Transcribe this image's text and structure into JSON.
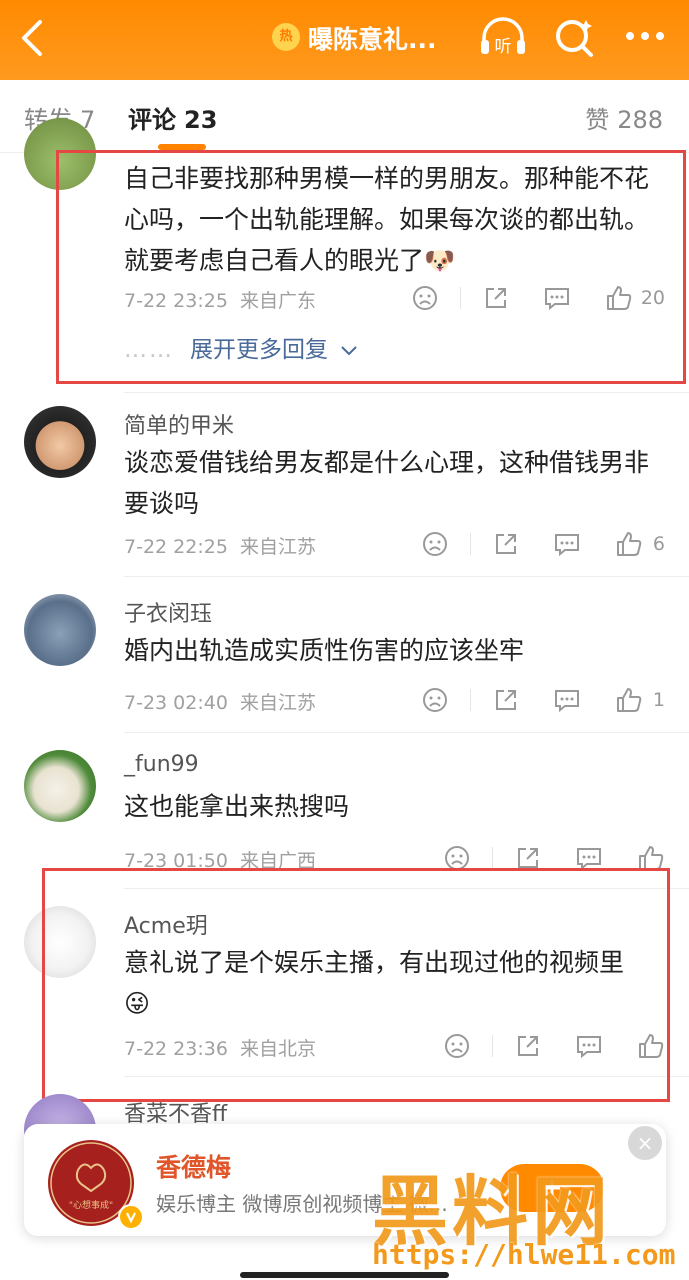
{
  "header": {
    "badge": "热",
    "title": "曝陈意礼...",
    "listen_label": "听"
  },
  "tabs": {
    "repost": {
      "label": "转发",
      "count": "7"
    },
    "comment": {
      "label": "评论",
      "count": "23"
    },
    "like": {
      "label": "赞",
      "count": "288"
    }
  },
  "comments": [
    {
      "username": "",
      "text": "自己非要找那种男模一样的男朋友。那种能不花心吗，一个出轨能理解。如果每次谈的都出轨。就要考虑自己看人的眼光了",
      "emoji": "🐶",
      "time": "7-22 23:25",
      "location": "来自广东",
      "likes": "20",
      "more_replies": "展开更多回复"
    },
    {
      "username": "简单的甲米",
      "text": "谈恋爱借钱给男友都是什么心理，这种借钱男非要谈吗",
      "time": "7-22 22:25",
      "location": "来自江苏",
      "likes": "6"
    },
    {
      "username": "子衣闵珏",
      "text": "婚内出轨造成实质性伤害的应该坐牢",
      "time": "7-23 02:40",
      "location": "来自江苏",
      "likes": "1"
    },
    {
      "username": "_fun99",
      "text": "这也能拿出来热搜吗",
      "time": "7-23 01:50",
      "location": "来自广西",
      "likes": ""
    },
    {
      "username": "Acme玥",
      "text": "意礼说了是个娱乐主播，有出现过他的视频里",
      "emoji": "😜",
      "time": "7-22 23:36",
      "location": "来自北京",
      "likes": ""
    },
    {
      "username": "香菜不香ff",
      "text": "",
      "time": "",
      "location": "",
      "likes": ""
    }
  ],
  "promo_card": {
    "name": "香德梅",
    "description": "娱乐博主 微博原创视频博主 微...",
    "logo_text": "\"心想事成\"",
    "close_label": "×"
  },
  "watermark": {
    "logo": "黑料网",
    "url": "https://hlwe11.com"
  },
  "colors": {
    "header_orange": "#ff8a00",
    "highlight_red": "#e54745",
    "link_blue": "#4a6a9a"
  }
}
